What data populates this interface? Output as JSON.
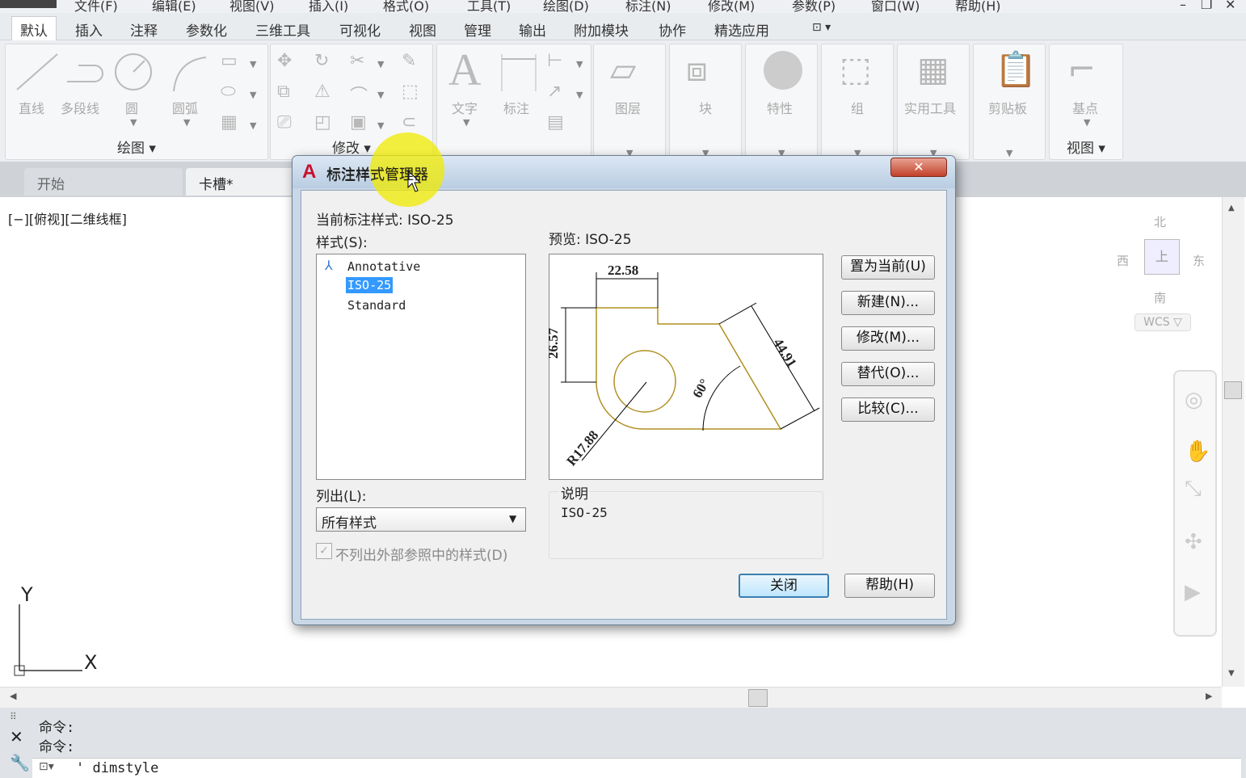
{
  "menubar": {
    "items": [
      "文件(F)",
      "编辑(E)",
      "视图(V)",
      "插入(I)",
      "格式(O)",
      "工具(T)",
      "绘图(D)",
      "标注(N)",
      "修改(M)",
      "参数(P)",
      "窗口(W)",
      "帮助(H)"
    ]
  },
  "ribbon_tabs": [
    "默认",
    "插入",
    "注释",
    "参数化",
    "三维工具",
    "可视化",
    "视图",
    "管理",
    "输出",
    "附加模块",
    "协作",
    "精选应用"
  ],
  "ribbon": {
    "draw": {
      "title": "绘图 ▾",
      "line": "直线",
      "polyline": "多段线",
      "circle": "圆",
      "arc": "圆弧"
    },
    "modify": {
      "title": "修改 ▾"
    },
    "annotation": {
      "text": "文字",
      "dim": "标注"
    },
    "layers": "图层",
    "block": "块",
    "properties": "特性",
    "group": "组",
    "utilities": "实用工具",
    "clipboard": "剪贴板",
    "base": "基点",
    "view_title": "视图 ▾"
  },
  "doc_tabs": {
    "start": "开始",
    "file": "卡槽*"
  },
  "viewport_label": "[−][俯视][二维线框]",
  "viewcube": {
    "north": "北",
    "south": "南",
    "east": "东",
    "west": "西",
    "top": "上",
    "wcs": "WCS ▽"
  },
  "ucs": {
    "y": "Y",
    "x": "X"
  },
  "command": {
    "line1": "命令:",
    "line2": "命令:",
    "input": "' dimstyle"
  },
  "dialog": {
    "title": "标注样式管理器",
    "close_x": "✕",
    "current_style_label": "当前标注样式: ISO-25",
    "styles_label": "样式(S):",
    "styles": [
      "Annotative",
      "ISO-25",
      "Standard"
    ],
    "preview_label": "预览: ISO-25",
    "list_label": "列出(L):",
    "list_value": "所有样式",
    "checkbox_label": "不列出外部参照中的样式(D)",
    "desc_label": "说明",
    "desc_value": "ISO-25",
    "buttons": {
      "set_current": "置为当前(U)",
      "new": "新建(N)...",
      "modify": "修改(M)...",
      "override": "替代(O)...",
      "compare": "比较(C)...",
      "close": "关闭",
      "help": "帮助(H)"
    },
    "preview_dims": {
      "width": "22.58",
      "height": "26.57",
      "slant": "44.91",
      "angle": "60°",
      "radius": "R17.88"
    }
  }
}
